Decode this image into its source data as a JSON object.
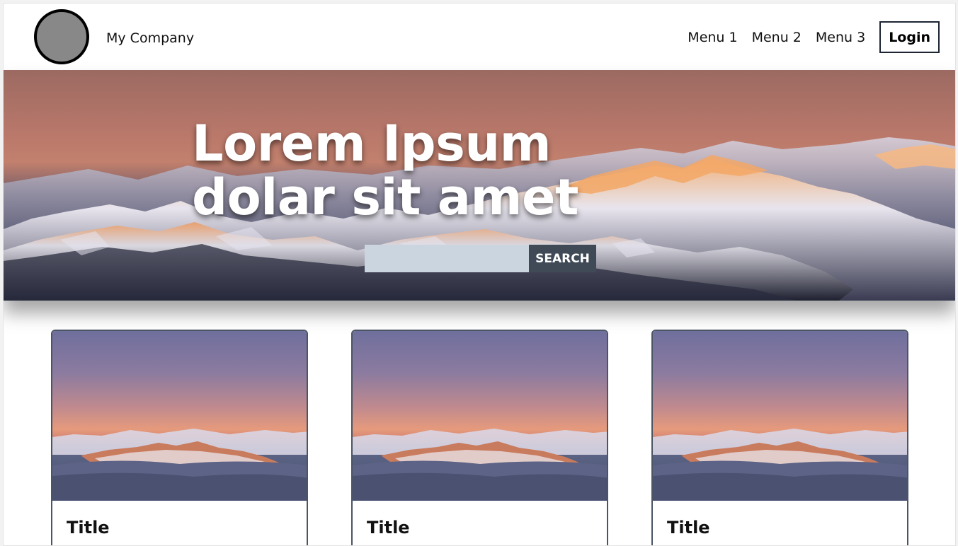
{
  "header": {
    "logo_icon": "company-logo-circle",
    "company_name": "My Company",
    "menu": [
      "Menu 1",
      "Menu 2",
      "Menu 3"
    ],
    "login_label": "Login"
  },
  "hero": {
    "title_line1": "Lorem Ipsum",
    "title_line2": "dolar sit amet",
    "search_placeholder": "",
    "search_button": "SEARCH",
    "image": "mountain-range-sunset-photo"
  },
  "cards": [
    {
      "title": "Title",
      "image": "mountain-sunset-over-clouds-photo"
    },
    {
      "title": "Title",
      "image": "mountain-sunset-over-clouds-photo"
    },
    {
      "title": "Title",
      "image": "mountain-sunset-over-clouds-photo"
    }
  ],
  "colors": {
    "logo_fill": "#888888",
    "search_input_bg": "#cbd5e0",
    "search_button_bg": "#3f4a56",
    "card_border": "#4b5563"
  }
}
